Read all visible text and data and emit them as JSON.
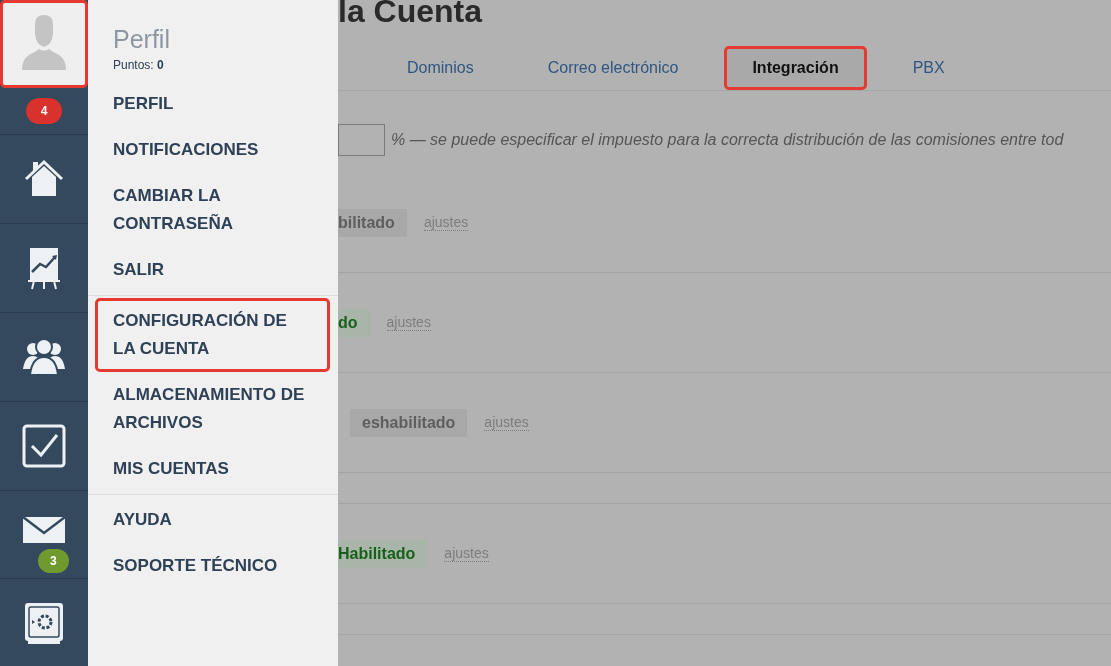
{
  "sidebar": {
    "avatar": {
      "highlighted": true
    },
    "badge": "4",
    "nav": [
      {
        "kind": "home"
      },
      {
        "kind": "chart"
      },
      {
        "kind": "people"
      },
      {
        "kind": "tasks"
      },
      {
        "kind": "mail",
        "badge": "3"
      },
      {
        "kind": "safe"
      }
    ]
  },
  "menu": {
    "title": "Perfil",
    "points": "Puntos: **0**",
    "groups": [
      [
        {
          "label": "PERFIL",
          "highlighted": false
        },
        {
          "label": "NOTIFICACIONES",
          "highlighted": false
        },
        {
          "label": "CAMBIAR LA CONTRASEÑA",
          "highlighted": false
        },
        {
          "label": "SALIR",
          "highlighted": false
        }
      ],
      [
        {
          "label": "CONFIGURACIÓN DE LA CUENTA",
          "highlighted": true
        },
        {
          "label": "ALMACENAMIENTO DE ARCHIVOS",
          "highlighted": false
        },
        {
          "label": "MIS CUENTAS",
          "highlighted": false
        }
      ],
      [
        {
          "label": "AYUDA",
          "highlighted": false
        },
        {
          "label": "SOPORTE TÉCNICO",
          "highlighted": false
        }
      ]
    ]
  },
  "page": {
    "title": "la Cuenta",
    "tabs": [
      {
        "label": "Dominios",
        "selected": false,
        "highlighted": false
      },
      {
        "label": "Correo electrónico",
        "selected": false,
        "highlighted": false
      },
      {
        "label": "Integración",
        "selected": true,
        "highlighted": true
      },
      {
        "label": "PBX",
        "selected": false,
        "highlighted": false
      }
    ],
    "tax_note": "% — se puede especificar el impuesto para la correcta distribución de las comisiones entre tod",
    "integrations": [
      {
        "status": "bilitado",
        "enabled": false,
        "link": "ajustes"
      },
      {
        "status": "do",
        "enabled": true,
        "link": "ajustes"
      },
      {
        "status": "eshabilitado",
        "enabled": false,
        "link": "ajustes"
      },
      {
        "status": "Habilitado",
        "enabled": true,
        "link": "ajustes"
      }
    ]
  }
}
